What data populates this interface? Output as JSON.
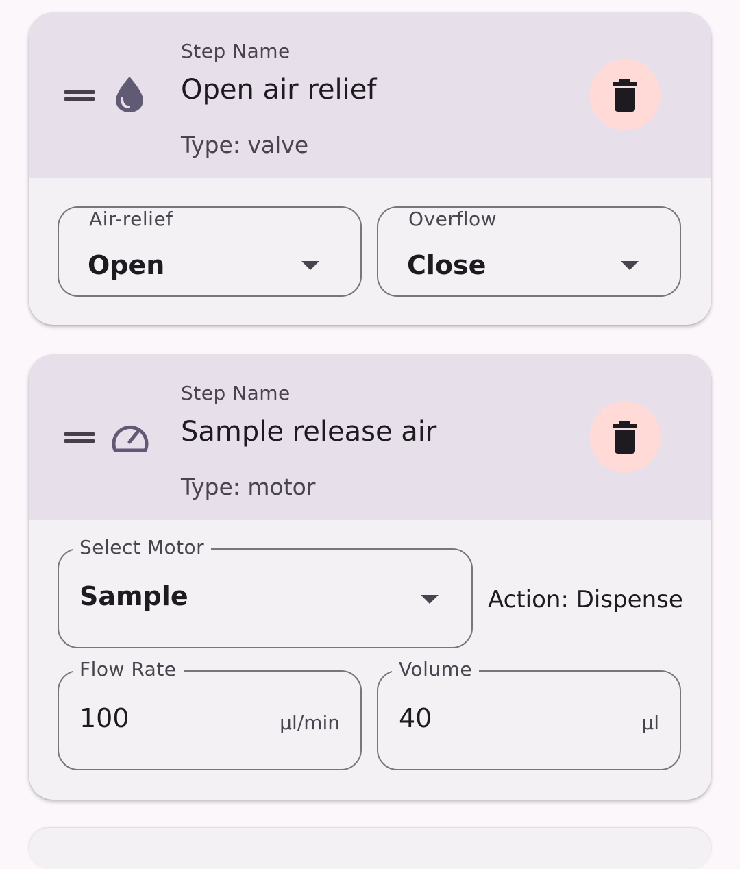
{
  "steps": [
    {
      "label": "Step Name",
      "name": "Open air relief",
      "type": "Type: valve",
      "icon": "water-drop-icon",
      "fields": [
        {
          "label": "Air-relief",
          "value": "Open"
        },
        {
          "label": "Overflow",
          "value": "Close"
        }
      ]
    },
    {
      "label": "Step Name",
      "name": "Sample release air",
      "type": "Type: motor",
      "icon": "speedometer-icon",
      "motor": {
        "label": "Select Motor",
        "value": "Sample"
      },
      "action": "Action: Dispense",
      "flow_rate": {
        "label": "Flow Rate",
        "value": "100",
        "unit": "µl/min"
      },
      "volume": {
        "label": "Volume",
        "value": "40",
        "unit": "µl"
      }
    }
  ],
  "icons": {
    "drag": "drag-handle-icon",
    "delete": "delete-icon",
    "dropdown": "arrow-drop-down-icon"
  },
  "colors": {
    "header": "#e7dfe9",
    "card": "#f3f1f4",
    "delete_bg": "#ffdad6",
    "icon_accent": "#615a74"
  }
}
